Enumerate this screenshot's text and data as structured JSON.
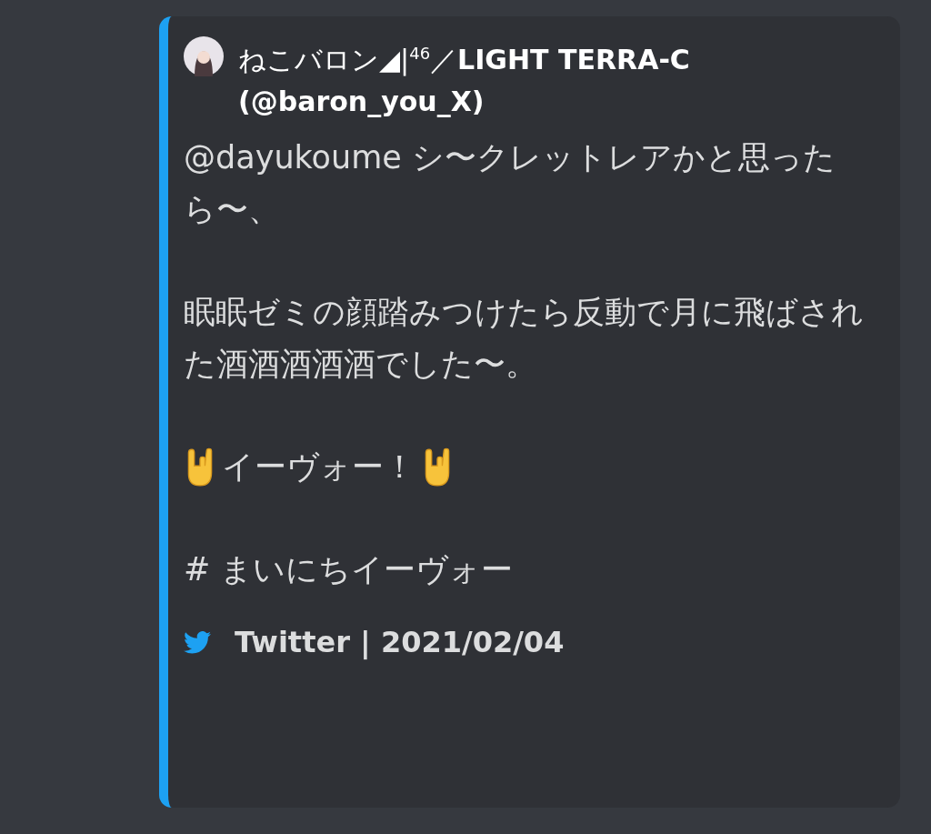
{
  "embed": {
    "color": "#1da1f2",
    "author": {
      "name": "ねこバロン◢|$^{46}$／**LIGHT TERRA-C (@baron_you_X)**"
    },
    "description": [
      {
        "kind": "text",
        "text": "@dayukoume シ〜クレットレアかと思ったら〜、"
      },
      {
        "kind": "text",
        "text": "眠眠ゼミの顔踏みつけたら反動で月に飛ばされた酒酒酒酒酒でした〜。"
      },
      {
        "kind": "emoji-line",
        "text": "イーヴォー！"
      },
      {
        "kind": "text",
        "text": "# まいにちイーヴォー"
      }
    ],
    "footer": {
      "text": "Twitter | 2021/02/04"
    }
  }
}
